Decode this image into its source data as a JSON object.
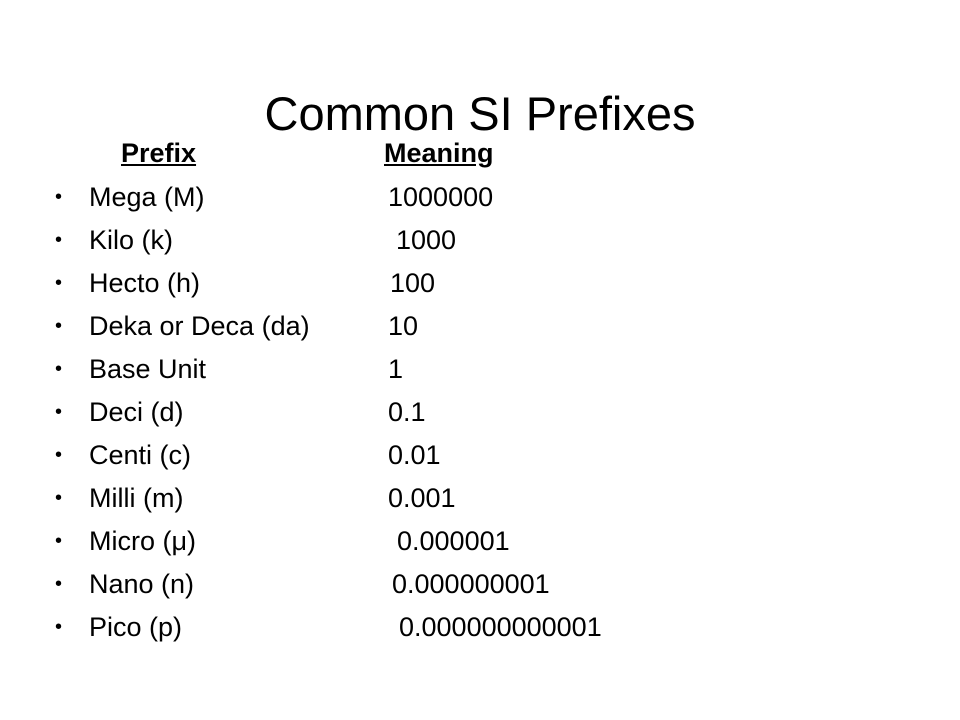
{
  "slide": {
    "title": "Common SI Prefixes",
    "background_color": "#ffffff",
    "text_color": "#000000"
  },
  "table": {
    "headers": {
      "prefix": "Prefix",
      "meaning": "Meaning"
    },
    "bullet_glyph": "•",
    "rows": [
      {
        "prefix": "Mega (M)",
        "meaning": "1000000",
        "value_offset": 388
      },
      {
        "prefix": "Kilo (k)",
        "meaning": "1000",
        "value_offset": 396
      },
      {
        "prefix": "Hecto (h)",
        "meaning": "100",
        "value_offset": 390
      },
      {
        "prefix": "Deka or Deca (da)",
        "meaning": "10",
        "value_offset": 388
      },
      {
        "prefix": "Base Unit",
        "meaning": "1",
        "value_offset": 388
      },
      {
        "prefix": "Deci (d)",
        "meaning": "0.1",
        "value_offset": 388
      },
      {
        "prefix": "Centi (c)",
        "meaning": "0.01",
        "value_offset": 388
      },
      {
        "prefix": "Milli (m)",
        "meaning": "0.001",
        "value_offset": 388
      },
      {
        "prefix": "Micro (μ)",
        "meaning": "0.000001",
        "value_offset": 397
      },
      {
        "prefix": "Nano (n)",
        "meaning": "0.000000001",
        "value_offset": 392
      },
      {
        "prefix": "Pico (p)",
        "meaning": "0.000000000001",
        "value_offset": 399
      }
    ]
  }
}
